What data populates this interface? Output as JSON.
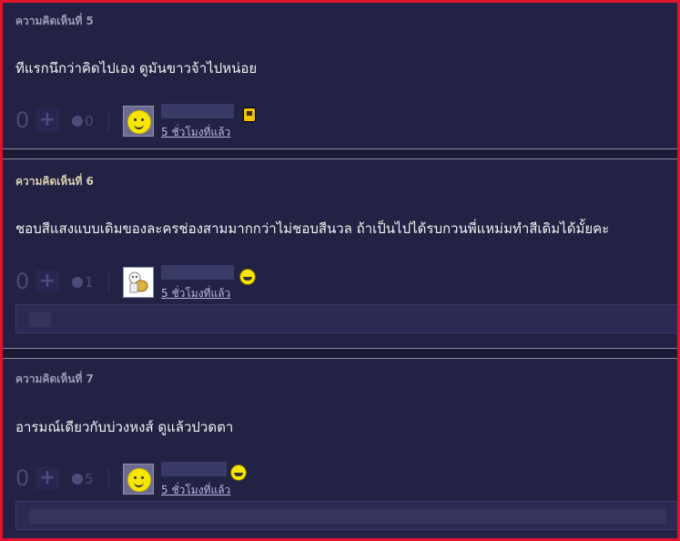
{
  "comments": [
    {
      "title": "ความคิดเห็นที่ 5",
      "body": "ทีแรกนึกว่าคิดไปเอง ดูมันขาวจ้าไปหน่อย",
      "votes": "0",
      "emotion_count": "0",
      "time": "5 ชั่วโมงที่แล้ว"
    },
    {
      "title": "ความคิดเห็นที่ 6",
      "body": "ชอบสีแสงแบบเดิมของละครช่องสามมากกว่าไม่ชอบสีนวล ถ้าเป็นไปได้รบกวนพี่แหม่มทำสีเดิมได้มั้ยคะ",
      "votes": "0",
      "emotion_count": "1",
      "time": "5 ชั่วโมงที่แล้ว"
    },
    {
      "title": "ความคิดเห็นที่ 7",
      "body": "อารมณ์เดียวกับบ่วงหงส์ ดูแล้วปวดตา",
      "votes": "0",
      "emotion_count": "5",
      "time": "5 ชั่วโมงที่แล้ว"
    }
  ],
  "colors": {
    "background": "#222244",
    "frame": "#e0132a",
    "title": "#9b9bb5",
    "body_text": "#f2f2f2",
    "link": "#b8b8e8"
  },
  "icons": {
    "plus": "plus-icon",
    "emotion": "emotion-face-icon",
    "avatar_smiley": "smiley-avatar-icon",
    "avatar_character": "character-avatar-icon",
    "badge_device": "device-badge-icon",
    "badge_grin": "grin-badge-icon"
  }
}
